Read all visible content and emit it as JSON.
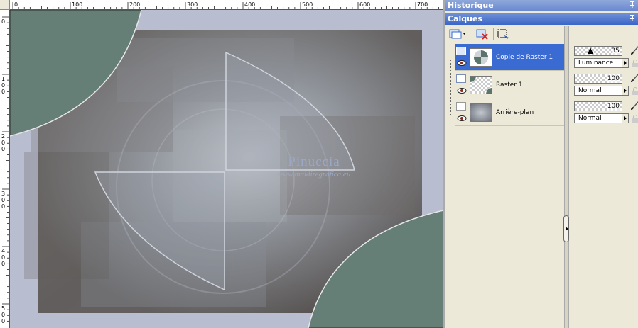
{
  "ruler": {
    "h_labels": [
      "0",
      "100",
      "200",
      "300",
      "400",
      "500",
      "600",
      "700"
    ],
    "v_labels": [
      "0",
      "1\n0\n0",
      "2\n0\n0",
      "3\n0\n0",
      "4\n0\n0",
      "5\n0\n0"
    ]
  },
  "watermark": {
    "title": "Pinuccia",
    "url": "www.maidiregrafica.eu"
  },
  "panels": {
    "history_title": "Historique",
    "layers_title": "Calques",
    "pin_glyph": "p"
  },
  "layers": [
    {
      "name": "Copie de Raster 1",
      "opacity": "35",
      "blend": "Luminance",
      "active": true
    },
    {
      "name": "Raster 1",
      "opacity": "100",
      "blend": "Normal",
      "active": false
    },
    {
      "name": "Arrière-plan",
      "opacity": "100",
      "blend": "Normal",
      "active": false
    }
  ],
  "colors": {
    "accent": "#3a6bd2",
    "canvas_bg": "#b8bdd0",
    "teal": "#6a7f76"
  },
  "icons": [
    "new-layer-icon",
    "delete-layer-icon",
    "layer-properties-icon",
    "eye-icon",
    "paintbrush-icon",
    "lock-icon",
    "pin-icon"
  ]
}
